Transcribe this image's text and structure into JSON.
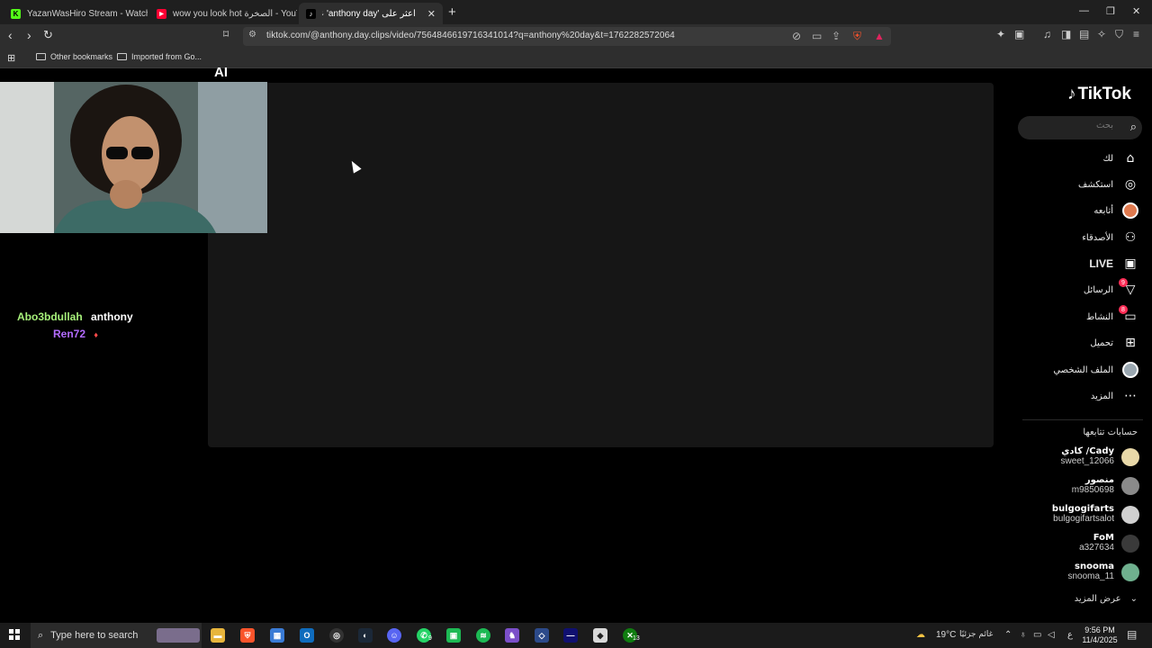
{
  "browser": {
    "tabs": [
      {
        "title": "YazanWasHiro Stream - Watch Live o",
        "favicon_color": "#53fc18",
        "favicon_letter": "K"
      },
      {
        "title": "wow you look hot الصخرة - YouTube",
        "favicon_color": "#ff0033",
        "favicon_letter": "▶"
      },
      {
        "title": "اعثر على 'anthony day' على TikTok",
        "favicon_color": "#000000",
        "favicon_letter": "♪"
      }
    ],
    "active_tab": 2,
    "new_tab_label": "+",
    "url": "tiktok.com/@anthony.day.clips/video/7564846619716341014?q=anthony%20day&t=1762282572064",
    "bookmarks": [
      {
        "label": "Other bookmarks"
      },
      {
        "label": "Imported from Go..."
      }
    ]
  },
  "stream_overlay": {
    "top_label": "AI",
    "chat_line1_user": "Abo3bdullah",
    "chat_line1_text": "anthony",
    "chat_line2_user": "Ren72",
    "colors": {
      "user1": "#a6f07a",
      "user2": "#b36cff"
    }
  },
  "tiktok": {
    "logo_text": "TikTok",
    "search_placeholder": "بحث",
    "nav": [
      {
        "label": "لك",
        "icon": "home-icon"
      },
      {
        "label": "استكشف",
        "icon": "compass-icon"
      },
      {
        "label": "أتابعه",
        "icon": "following-avatar-icon"
      },
      {
        "label": "الأصدقاء",
        "icon": "friends-icon"
      },
      {
        "label": "LIVE",
        "icon": "live-icon"
      },
      {
        "label": "الرسائل",
        "icon": "messages-icon",
        "badge": "9"
      },
      {
        "label": "النشاط",
        "icon": "activity-icon",
        "badge": "8"
      },
      {
        "label": "تحميل",
        "icon": "upload-icon"
      },
      {
        "label": "الملف الشخصي",
        "icon": "profile-icon"
      },
      {
        "label": "المزيد",
        "icon": "more-icon"
      }
    ],
    "following_title": "حسابات تتابعها",
    "following": [
      {
        "name": "كادي /Cady",
        "handle": "sweet_12066"
      },
      {
        "name": "منصور",
        "handle": "m9850698"
      },
      {
        "name": "bulgogifarts",
        "handle": "bulgogifartsalot"
      },
      {
        "name": "FoM",
        "handle": "a327634"
      },
      {
        "name": "snooma",
        "handle": "snooma_11"
      }
    ],
    "see_more": "عرض المزيد"
  },
  "taskbar": {
    "search_placeholder": "Type here to search",
    "weather": "19°C",
    "weather_text": "غائم جزئيًا",
    "lang": "ع",
    "time": "9:56 PM",
    "date": "11/4/2025",
    "xbox_badge": "13",
    "whatsapp_badge": "9"
  }
}
